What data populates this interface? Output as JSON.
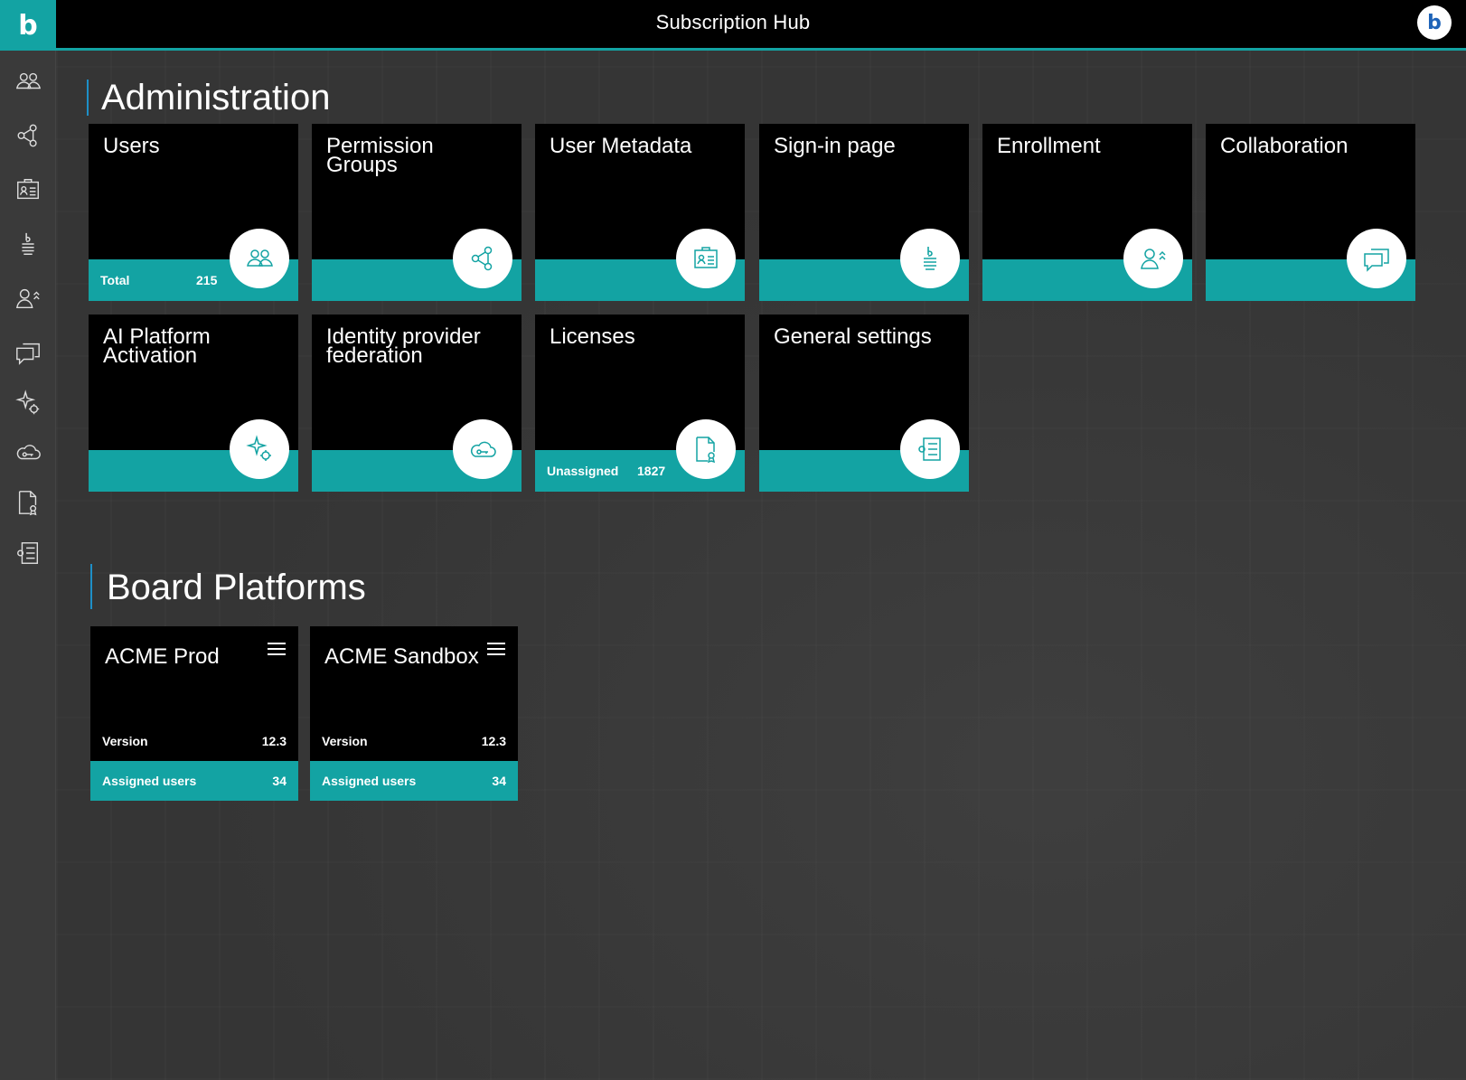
{
  "app": {
    "logo_glyph": "b",
    "title": "Subscription Hub",
    "avatar_glyph": "b"
  },
  "sidebar": {
    "items": [
      {
        "icon": "users-icon"
      },
      {
        "icon": "share-nodes-icon"
      },
      {
        "icon": "id-card-icon"
      },
      {
        "icon": "sign-in-icon"
      },
      {
        "icon": "user-enroll-icon"
      },
      {
        "icon": "chat-icon"
      },
      {
        "icon": "ai-sparkle-icon"
      },
      {
        "icon": "cloud-key-icon"
      },
      {
        "icon": "license-icon"
      },
      {
        "icon": "settings-list-icon"
      }
    ]
  },
  "administration": {
    "title": "Administration",
    "tiles": [
      {
        "name": "Users",
        "icon": "users-icon",
        "band_label": "Total",
        "band_value": "215"
      },
      {
        "name": "Permission Groups",
        "icon": "share-nodes-icon"
      },
      {
        "name": "User Metadata",
        "icon": "id-card-icon"
      },
      {
        "name": "Sign-in page",
        "icon": "sign-in-icon"
      },
      {
        "name": "Enrollment",
        "icon": "user-enroll-icon"
      },
      {
        "name": "Collaboration",
        "icon": "chat-icon"
      },
      {
        "name": "AI Platform Activation",
        "icon": "ai-sparkle-icon"
      },
      {
        "name": "Identity provider federation",
        "icon": "cloud-key-icon"
      },
      {
        "name": "Licenses",
        "icon": "license-icon",
        "band_label": "Unassigned",
        "band_value": "1827"
      },
      {
        "name": "General settings",
        "icon": "settings-list-icon"
      }
    ]
  },
  "platforms": {
    "title": "Board Platforms",
    "cards": [
      {
        "name": "ACME Prod",
        "version_label": "Version",
        "version": "12.3",
        "users_label": "Assigned users",
        "users": "34"
      },
      {
        "name": "ACME Sandbox",
        "version_label": "Version",
        "version": "12.3",
        "users_label": "Assigned users",
        "users": "34"
      }
    ]
  },
  "colors": {
    "accent": "#13a3a3",
    "topbar": "#000000",
    "tile": "#000000",
    "section_marker": "#1e8fc7"
  }
}
